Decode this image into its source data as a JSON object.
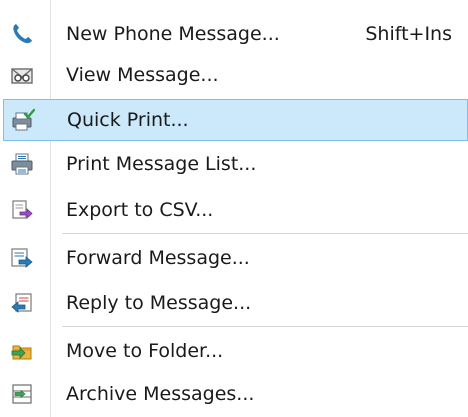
{
  "menu": {
    "items": [
      {
        "label": "New Phone Message...",
        "shortcut": "Shift+Ins",
        "icon": "phone-icon"
      },
      {
        "label": "View Message...",
        "icon": "view-message-icon"
      },
      {
        "label": "Quick Print...",
        "icon": "quick-print-icon",
        "selected": true
      },
      {
        "label": "Print Message List...",
        "icon": "printer-icon"
      },
      {
        "label": "Export to CSV...",
        "icon": "export-csv-icon"
      },
      {
        "label": "Forward Message...",
        "icon": "forward-message-icon"
      },
      {
        "label": "Reply to Message...",
        "icon": "reply-message-icon"
      },
      {
        "label": "Move to Folder...",
        "icon": "move-folder-icon"
      },
      {
        "label": "Archive Messages...",
        "icon": "archive-icon"
      }
    ]
  },
  "colors": {
    "selection_bg": "#cce8fb",
    "selection_border": "#7ec0ee",
    "phone_blue": "#2a7ab8"
  }
}
